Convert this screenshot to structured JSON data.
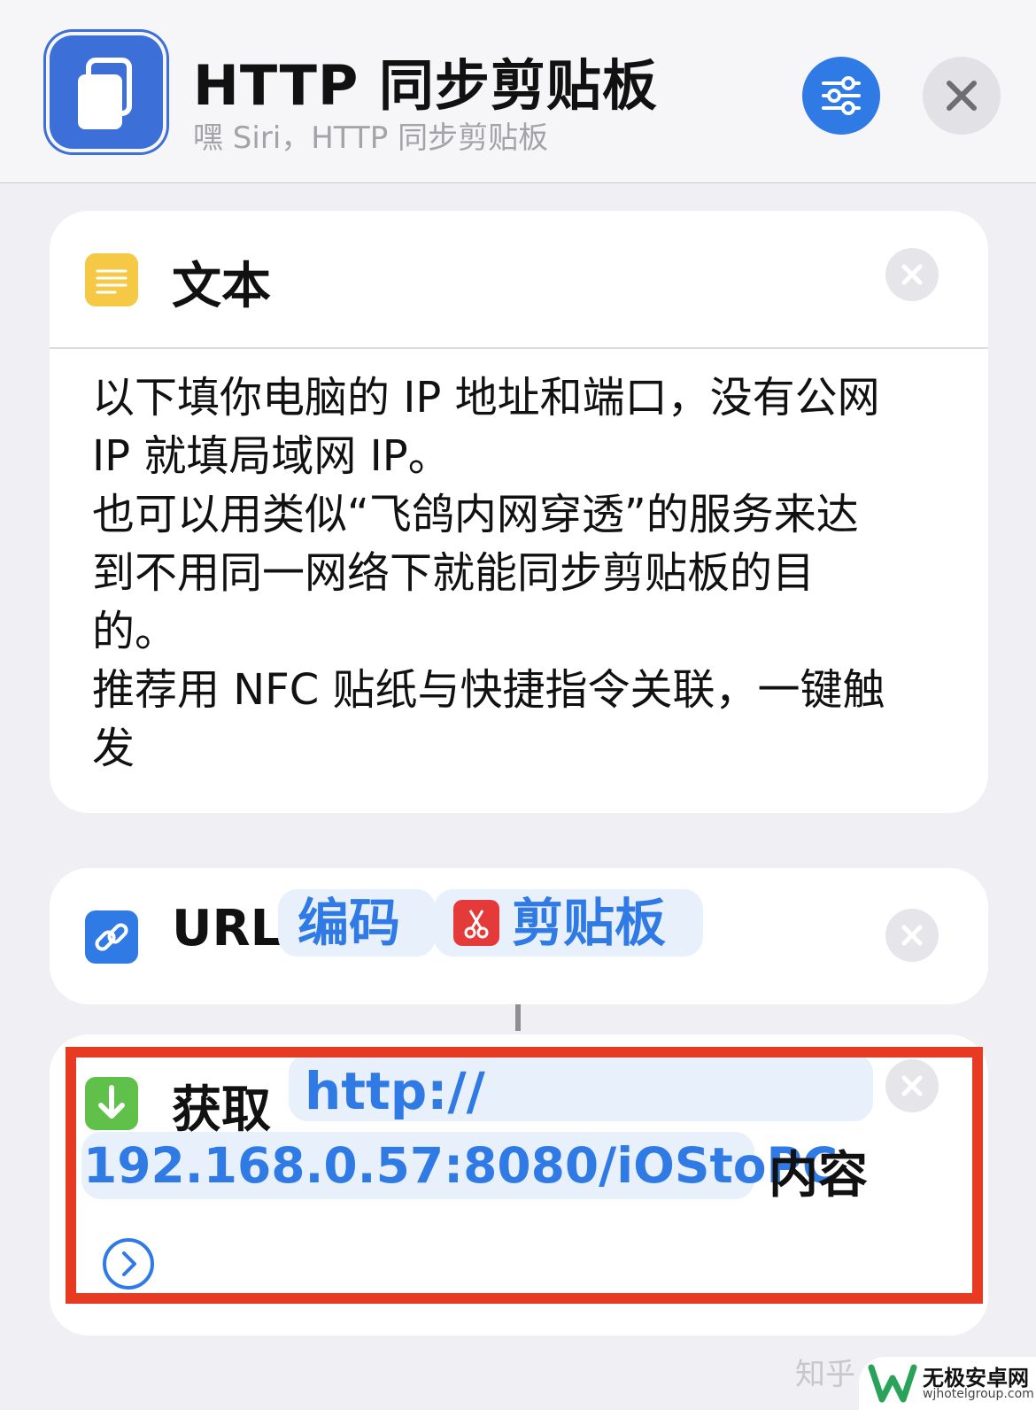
{
  "header": {
    "title": "HTTP 同步剪贴板",
    "subtitle": "嘿 Siri，HTTP 同步剪贴板",
    "settings_icon": "sliders-icon",
    "close_icon": "close-icon"
  },
  "text_action": {
    "label": "文本",
    "icon": "text-document-icon",
    "body": "以下填你电脑的 IP 地址和端口，没有公网\nIP 就填局域网 IP。\n也可以用类似“飞鸽内网穿透”的服务来达\n到不用同一网络下就能同步剪贴板的目\n的。\n推荐用 NFC 贴纸与快捷指令关联，一键触\n发"
  },
  "url_action": {
    "label": "URL",
    "icon": "link-icon",
    "token_encode": "编码",
    "token_clipboard": "剪贴板",
    "token_clipboard_icon": "scissors-icon"
  },
  "get_action": {
    "label": "获取",
    "icon": "download-arrow-icon",
    "url_part1": "http://",
    "url_part2": "192.168.0.57:8080/iOStoPC",
    "suffix": "内容",
    "expand_icon": "chevron-right-circle-icon"
  },
  "watermark": {
    "text": "知乎 @...",
    "site_title": "无极安卓网",
    "site_url": "wjhotelgroup.com"
  },
  "colors": {
    "accent": "#2f7ae5",
    "highlight": "#e63b22",
    "text_icon": "#f5c945",
    "get_icon": "#5fc14a",
    "clipboard_icon": "#e53a3a"
  }
}
